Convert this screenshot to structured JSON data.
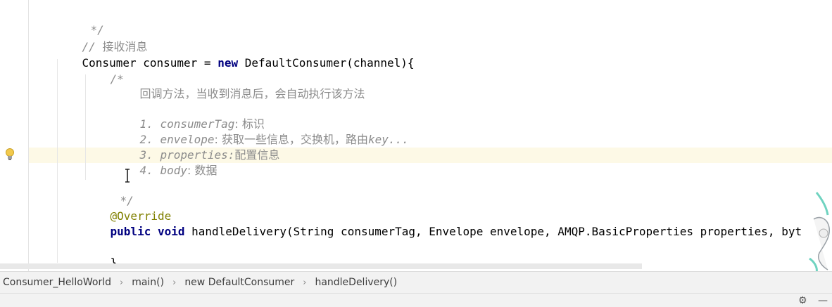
{
  "editor": {
    "lines": {
      "l1": "*/",
      "l2_prefix": "// ",
      "l2_text": "接收消息",
      "l3_type": "Consumer consumer = ",
      "l3_kw": "new",
      "l3_rest": " DefaultConsumer(channel){",
      "l4": "/*",
      "l5": "回调方法，当收到消息后，会自动执行该方法",
      "l7_num": "1. ",
      "l7_tag": "consumerTag",
      "l7_sep": ": ",
      "l7_desc": "标识",
      "l8_num": "2. ",
      "l8_tag": "envelope",
      "l8_sep": ": ",
      "l8_desc": "获取一些信息，交换机，路由",
      "l8_tail": "key...",
      "l9_num": "3. ",
      "l9_tag": "properties",
      "l9_sep": ":",
      "l9_desc": "配置信息",
      "l10_num": "4. ",
      "l10_tag": "body",
      "l10_sep": ": ",
      "l10_desc": "数据",
      "l12": "*/",
      "l13": "@Override",
      "l14_kw1": "public",
      "l14_kw2": "void",
      "l14_rest": " handleDelivery(String consumerTag, Envelope envelope, AMQP.BasicProperties properties, byt",
      "l16": "}",
      "l17": "};"
    }
  },
  "breadcrumb": {
    "items": [
      "Consumer_HelloWorld",
      "main()",
      "new DefaultConsumer",
      "handleDelivery()"
    ]
  },
  "status": {
    "settings_icon": "gear-icon",
    "minimize_icon": "minus-icon"
  },
  "colors": {
    "keyword": "#000080",
    "comment": "#8c8c8c",
    "annotation": "#808000",
    "caret_row": "#fdf9e6"
  }
}
